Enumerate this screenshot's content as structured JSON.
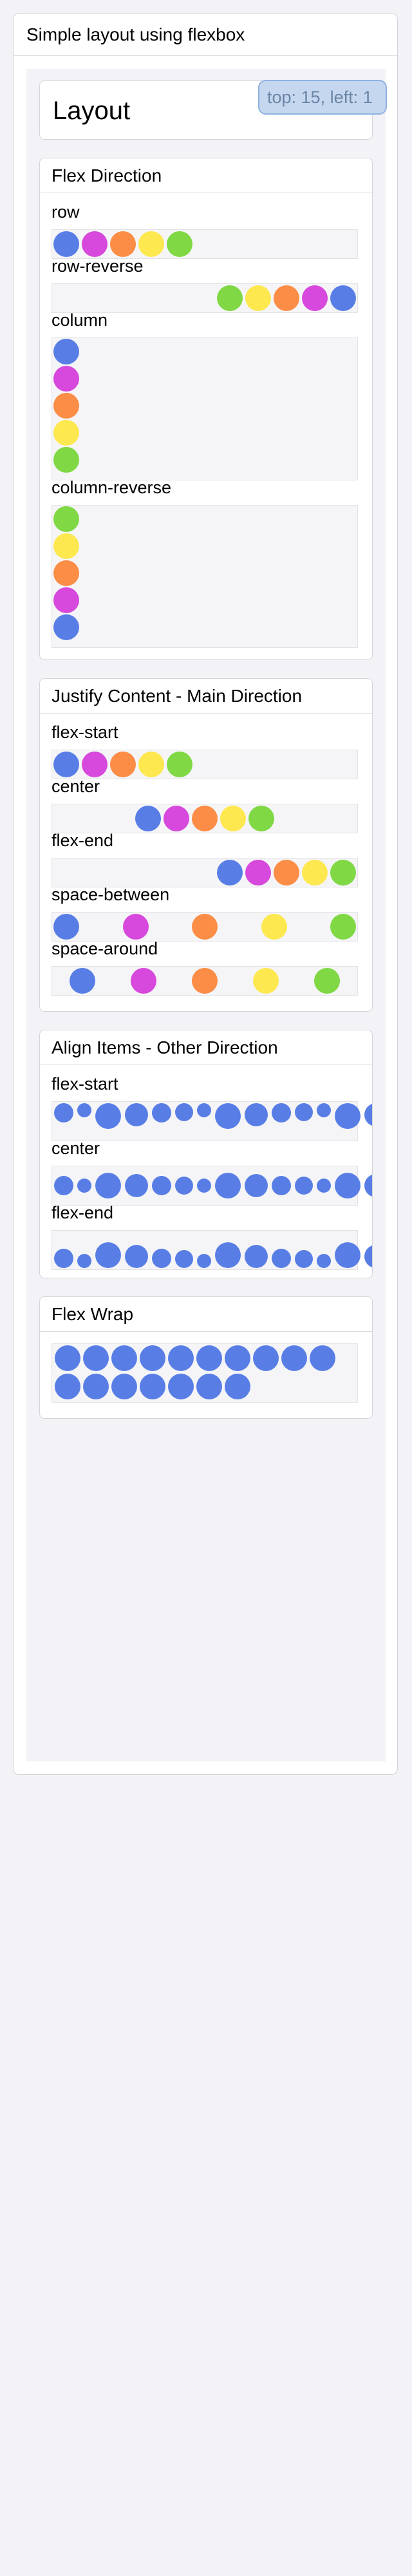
{
  "window": {
    "title": "Simple layout using flexbox"
  },
  "layout": {
    "title": "Layout"
  },
  "colors": {
    "blue": "#587ee6",
    "magenta": "#d748dc",
    "orange": "#fb8d46",
    "yellow": "#fde850",
    "green": "#7fd844"
  },
  "direction": {
    "title": "Flex Direction",
    "row": "row",
    "row_reverse": "row-reverse",
    "column": "column",
    "column_reverse": "column-reverse",
    "tooltip": "top: 15, left: 1"
  },
  "justify": {
    "title": "Justify Content - Main Direction",
    "flex_start": "flex-start",
    "center": "center",
    "flex_end": "flex-end",
    "space_between": "space-between",
    "space_around": "space-around"
  },
  "align": {
    "title": "Align Items - Other Direction",
    "flex_start": "flex-start",
    "center": "center",
    "flex_end": "flex-end"
  },
  "wrap": {
    "title": "Flex Wrap"
  }
}
